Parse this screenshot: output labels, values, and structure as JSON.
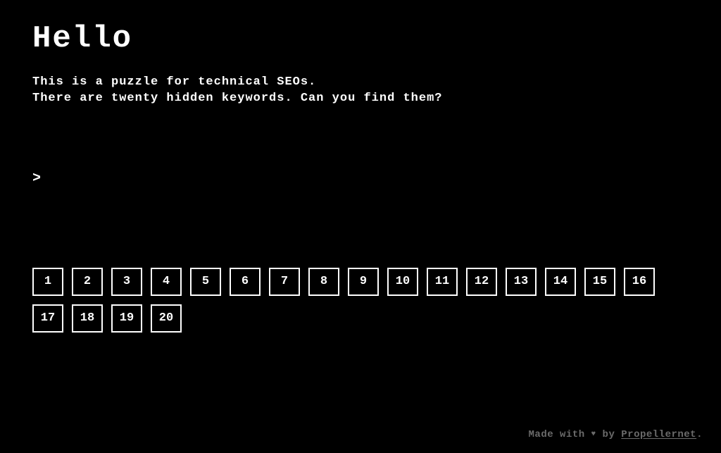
{
  "header": {
    "title": "Hello"
  },
  "intro": {
    "line1": "This is a puzzle for technical SEOs.",
    "line2": "There are twenty hidden keywords. Can you find them?"
  },
  "prompt": {
    "symbol": ">",
    "value": ""
  },
  "boxes": [
    "1",
    "2",
    "3",
    "4",
    "5",
    "6",
    "7",
    "8",
    "9",
    "10",
    "11",
    "12",
    "13",
    "14",
    "15",
    "16",
    "17",
    "18",
    "19",
    "20"
  ],
  "footer": {
    "prefix": "Made with ",
    "heart": "♥",
    "by": " by ",
    "link_text": "Propellernet",
    "suffix": "."
  }
}
